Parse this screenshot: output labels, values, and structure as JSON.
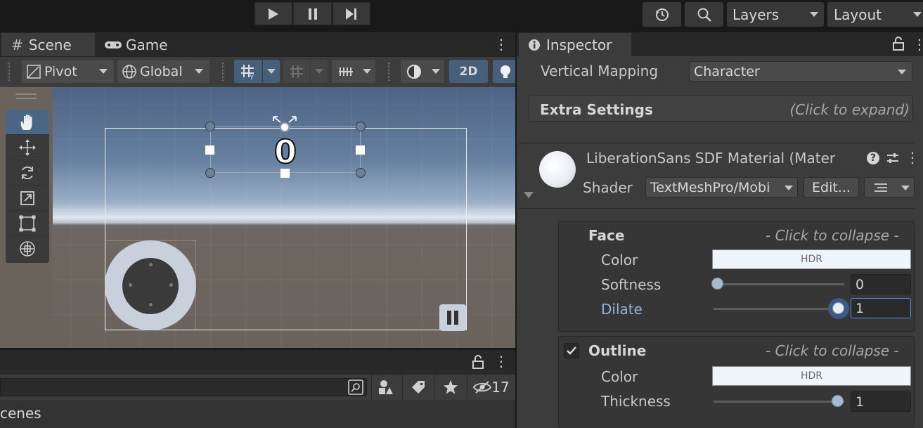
{
  "toolbar": {
    "layers_label": "Layers",
    "layout_label": "Layout"
  },
  "tabs": {
    "scene": "Scene",
    "game": "Game",
    "inspector": "Inspector"
  },
  "scene_toolbar": {
    "pivot": "Pivot",
    "global": "Global",
    "mode_2d": "2D"
  },
  "viewport": {
    "counter_text": "0"
  },
  "project": {
    "hidden_count": "17",
    "scenes_label": "cenes"
  },
  "inspector": {
    "vertical_mapping_label": "Vertical Mapping",
    "vertical_mapping_value": "Character",
    "extra_settings_label": "Extra Settings",
    "extra_settings_hint": "(Click to expand)",
    "material_name": "LiberationSans SDF Material (Mater",
    "shader_label": "Shader",
    "shader_value": "TextMeshPro/Mobi",
    "edit_button": "Edit...",
    "face": {
      "title": "Face",
      "hint": "- Click to collapse -",
      "color_label": "Color",
      "color_value": "HDR",
      "softness_label": "Softness",
      "softness_value": "0",
      "dilate_label": "Dilate",
      "dilate_value": "1"
    },
    "outline": {
      "title": "Outline",
      "hint": "- Click to collapse -",
      "color_label": "Color",
      "color_value": "HDR",
      "thickness_label": "Thickness",
      "thickness_value": "1"
    }
  },
  "colors": {
    "accent": "#46607c",
    "hdr_swatch": "#eef6fb",
    "slider_knob": "#a9b8cc"
  }
}
